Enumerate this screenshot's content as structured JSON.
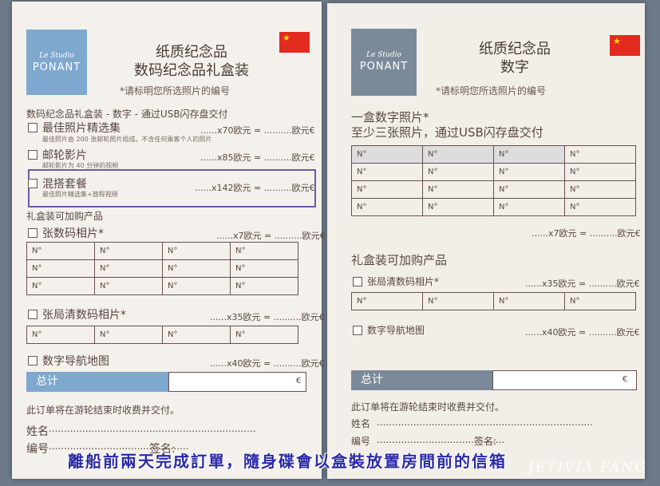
{
  "left": {
    "logo_script": "Le Studio",
    "logo_name": "PONANT",
    "title_line1": "纸质纪念品",
    "title_line2": "数码纪念品礼盒装",
    "subtitle": "*请标明您所选照片的编号",
    "section1": "数码纪念品礼盒装 - 数字 - 通过USB闪存盘交付",
    "item1_name": "最佳照片精选集",
    "item1_desc": "最佳照片由 200 张邮轮照片组成。不含任何乘客个人的照片",
    "item1_price": "......x70欧元 = ..........欧元€",
    "item2_name": "邮轮影片",
    "item2_desc": "邮轮影片为 40 分钟的视频",
    "item2_price": "......x85欧元 = ..........欧元€",
    "item3_name": "混搭套餐",
    "item3_desc": "最佳照片精选集+旅程视频",
    "item3_price": "......x142欧元 = ..........欧元€",
    "section2": "礼盒装可加购产品",
    "addon1_name": "张数码相片*",
    "addon1_price": "......x7欧元 = ..........欧元€",
    "cell": "N°",
    "addon2_name": "张局清数码相片*",
    "addon2_price": "......x35欧元 = ..........欧元€",
    "addon3_name": "数字导航地图",
    "addon3_price": "......x40欧元 = ..........欧元€",
    "total_label": "总计",
    "euro": "€",
    "footer": "此订单将在游轮结束时收费并交付。",
    "name_label": "姓名",
    "number_label": "编号",
    "sign_label": "签名:"
  },
  "right": {
    "logo_script": "Le Studio",
    "logo_name": "PONANT",
    "title_line1": "纸质纪念品",
    "title_line2": "数字",
    "subtitle": "*请标明您所选照片的编号",
    "section1_line1": "一盒数字照片*",
    "section1_line2": "至少三张照片，通过USB闪存盘交付",
    "cell": "N°",
    "price1": "......x7欧元 = ..........欧元€",
    "section2": "礼盒装可加购产品",
    "addon1_name": "张局清数码相片*",
    "addon1_price": "......x35欧元 = ..........欧元€",
    "addon2_name": "数字导航地图",
    "addon2_price": "......x40欧元 = ..........欧元€",
    "total_label": "总计",
    "euro": "€",
    "footer": "此订单将在游轮结束时收费并交付。",
    "name_label": "姓名",
    "number_label": "编号",
    "sign_label": "签名:"
  },
  "caption": "離船前兩天完成訂單，隨身碟會以盒裝放置房間前的信箱",
  "watermark": "JETIVIA FANG",
  "colors": {
    "left_accent": "#7fa8cf",
    "right_accent": "#7b8a99",
    "highlight": "#6a5aa8",
    "caption": "#2a2aa8"
  }
}
